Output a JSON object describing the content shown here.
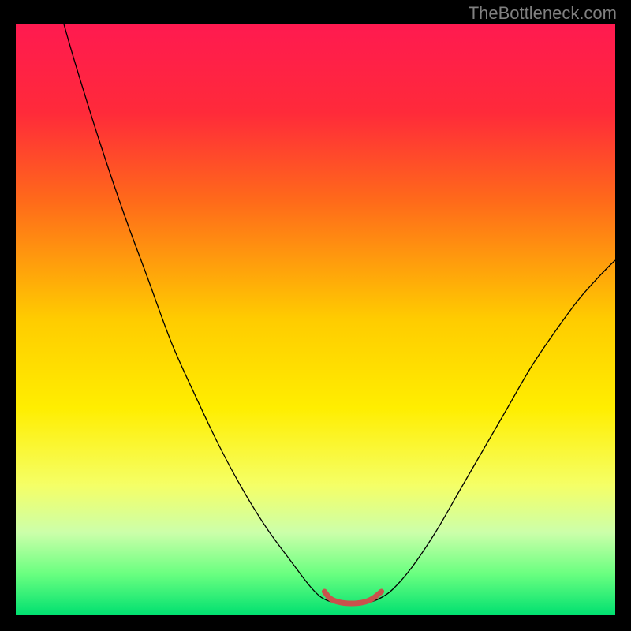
{
  "watermark": "TheBottleneck.com",
  "chart_data": {
    "type": "line",
    "title": "",
    "xlabel": "",
    "ylabel": "",
    "xlim": [
      0,
      100
    ],
    "ylim": [
      0,
      100
    ],
    "gradient_stops": [
      {
        "offset": 0,
        "color": "#ff1a50"
      },
      {
        "offset": 15,
        "color": "#ff2a3a"
      },
      {
        "offset": 30,
        "color": "#ff6a1a"
      },
      {
        "offset": 50,
        "color": "#ffcc00"
      },
      {
        "offset": 65,
        "color": "#ffee00"
      },
      {
        "offset": 78,
        "color": "#f5ff66"
      },
      {
        "offset": 86,
        "color": "#ccffaa"
      },
      {
        "offset": 93,
        "color": "#6aff80"
      },
      {
        "offset": 100,
        "color": "#00e070"
      }
    ],
    "series": [
      {
        "name": "bottleneck-curve",
        "stroke": "#000000",
        "width": 1.3,
        "points": [
          {
            "x": 8.0,
            "y": 100.0
          },
          {
            "x": 10.0,
            "y": 93.0
          },
          {
            "x": 14.0,
            "y": 80.0
          },
          {
            "x": 18.0,
            "y": 68.0
          },
          {
            "x": 22.0,
            "y": 57.0
          },
          {
            "x": 26.0,
            "y": 46.0
          },
          {
            "x": 30.0,
            "y": 37.0
          },
          {
            "x": 34.0,
            "y": 28.5
          },
          {
            "x": 38.0,
            "y": 21.0
          },
          {
            "x": 42.0,
            "y": 14.5
          },
          {
            "x": 46.0,
            "y": 9.0
          },
          {
            "x": 49.0,
            "y": 5.0
          },
          {
            "x": 51.0,
            "y": 3.0
          },
          {
            "x": 53.0,
            "y": 2.2
          },
          {
            "x": 55.0,
            "y": 2.0
          },
          {
            "x": 57.0,
            "y": 2.0
          },
          {
            "x": 59.0,
            "y": 2.2
          },
          {
            "x": 61.0,
            "y": 3.0
          },
          {
            "x": 63.0,
            "y": 4.5
          },
          {
            "x": 66.0,
            "y": 8.0
          },
          {
            "x": 70.0,
            "y": 14.0
          },
          {
            "x": 74.0,
            "y": 21.0
          },
          {
            "x": 78.0,
            "y": 28.0
          },
          {
            "x": 82.0,
            "y": 35.0
          },
          {
            "x": 86.0,
            "y": 42.0
          },
          {
            "x": 90.0,
            "y": 48.0
          },
          {
            "x": 94.0,
            "y": 53.5
          },
          {
            "x": 98.0,
            "y": 58.0
          },
          {
            "x": 100.0,
            "y": 60.0
          }
        ]
      },
      {
        "name": "optimal-range",
        "stroke": "#c9524c",
        "width": 7,
        "cap": "round",
        "points": [
          {
            "x": 51.5,
            "y": 4.0
          },
          {
            "x": 52.5,
            "y": 2.8
          },
          {
            "x": 54.0,
            "y": 2.2
          },
          {
            "x": 56.0,
            "y": 2.0
          },
          {
            "x": 58.0,
            "y": 2.2
          },
          {
            "x": 59.5,
            "y": 2.8
          },
          {
            "x": 61.0,
            "y": 4.0
          }
        ]
      }
    ]
  }
}
